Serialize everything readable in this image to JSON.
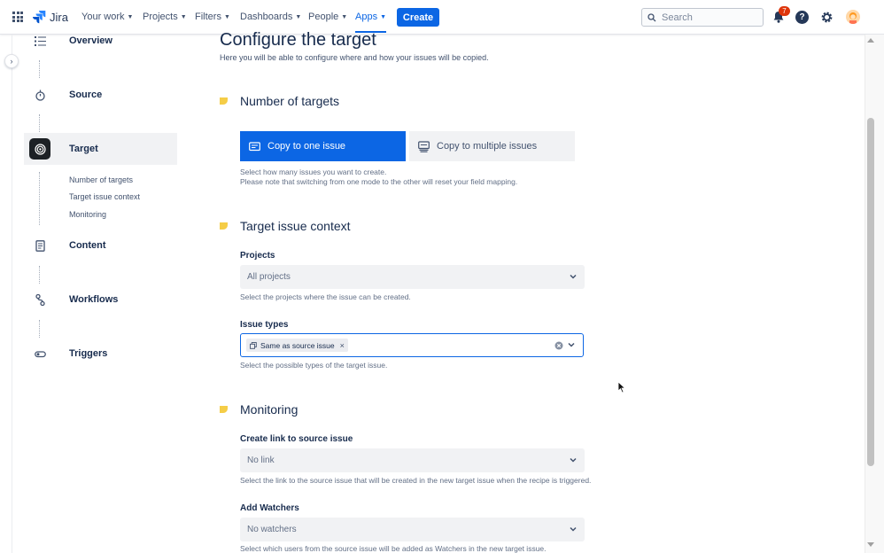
{
  "topnav": {
    "brand": "Jira",
    "items": [
      {
        "label": "Your work",
        "chevron": "chevron-down-icon"
      },
      {
        "label": "Projects",
        "chevron": "chevron-down-icon"
      },
      {
        "label": "Filters",
        "chevron": "chevron-down-icon"
      },
      {
        "label": "Dashboards",
        "chevron": "chevron-down-icon"
      },
      {
        "label": "People",
        "chevron": "chevron-down-icon"
      },
      {
        "label": "Apps",
        "chevron": "chevron-down-icon",
        "active": true
      }
    ],
    "create_label": "Create",
    "search_placeholder": "Search",
    "notifications_count": "7",
    "help_glyph": "?",
    "accent_color": "#0c66e4"
  },
  "sidebar": {
    "steps": [
      {
        "label": "Overview",
        "icon": "list-icon"
      },
      {
        "label": "Source",
        "icon": "timer-icon"
      },
      {
        "label": "Target",
        "icon": "target-icon",
        "selected": true
      },
      {
        "label": "Content",
        "icon": "document-icon"
      },
      {
        "label": "Workflows",
        "icon": "workflow-icon"
      },
      {
        "label": "Triggers",
        "icon": "toggle-icon"
      }
    ],
    "target_substeps": [
      "Number of targets",
      "Target issue context",
      "Monitoring"
    ]
  },
  "main": {
    "title": "Configure the target",
    "subtitle": "Here you will be able to configure where and how your issues will be copied.",
    "number_of_targets": {
      "heading": "Number of targets",
      "options": [
        {
          "label": "Copy to one issue",
          "icon": "single-issue-icon",
          "selected": true
        },
        {
          "label": "Copy to multiple issues",
          "icon": "multiple-issues-icon",
          "selected": false
        }
      ],
      "helper_line1": "Select how many issues you want to create.",
      "helper_line2": "Please note that switching from one mode to the other will reset your field mapping."
    },
    "target_issue_context": {
      "heading": "Target issue context",
      "projects": {
        "label": "Projects",
        "value": "All projects",
        "helper": "Select the projects where the issue can be created."
      },
      "issue_types": {
        "label": "Issue types",
        "selected_tag": "Same as source issue",
        "tag_remove": "×",
        "helper": "Select the possible types of the target issue."
      }
    },
    "monitoring": {
      "heading": "Monitoring",
      "create_link": {
        "label": "Create link to source issue",
        "value": "No link",
        "helper": "Select the link to the source issue that will be created in the new target issue when the recipe is triggered."
      },
      "add_watchers": {
        "label": "Add Watchers",
        "value": "No watchers",
        "helper": "Select which users from the source issue will be added as Watchers in the new target issue."
      }
    }
  }
}
